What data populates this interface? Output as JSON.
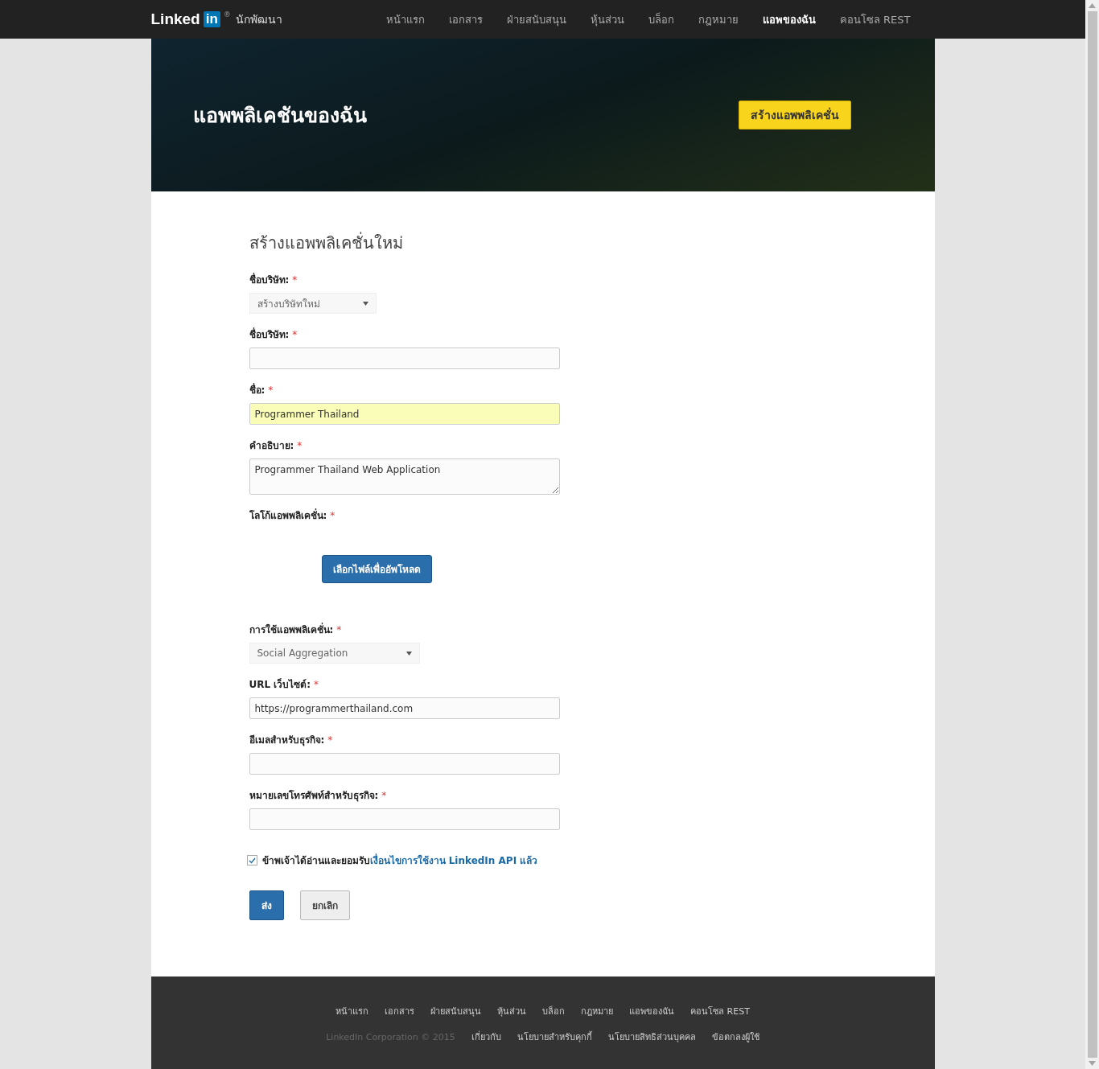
{
  "nav": {
    "logo_word": "Linked",
    "logo_badge": "in",
    "logo_mark": "®",
    "subtitle": "นักพัฒนา",
    "items": [
      {
        "label": "หน้าแรก",
        "selected": false
      },
      {
        "label": "เอกสาร",
        "selected": false
      },
      {
        "label": "ฝ่ายสนับสนุน",
        "selected": false
      },
      {
        "label": "หุ้นส่วน",
        "selected": false
      },
      {
        "label": "บล็อก",
        "selected": false
      },
      {
        "label": "กฎหมาย",
        "selected": false
      },
      {
        "label": "แอพของฉัน",
        "selected": true
      },
      {
        "label": "คอนโซล REST",
        "selected": false
      }
    ]
  },
  "hero": {
    "title": "แอพพลิเคชันของฉัน",
    "button": "สร้างแอพพลิเคชั่น"
  },
  "form": {
    "heading": "สร้างแอพพลิเคชั่นใหม่",
    "required_mark": "*",
    "fields": [
      {
        "kind": "select",
        "label": "ชื่อบริษัท:",
        "required": true,
        "value": "สร้างบริษัทใหม่"
      },
      {
        "kind": "input",
        "label": "ชื่อบริษัท:",
        "required": true,
        "autofilled": false
      },
      {
        "kind": "input",
        "label": "ชื่อ:",
        "required": true,
        "value": "Programmer Thailand",
        "autofilled": true
      },
      {
        "kind": "textarea",
        "label": "คำอธิบาย:",
        "required": true,
        "value": "Programmer Thailand Web Application"
      },
      {
        "kind": "file",
        "label": "โลโก้แอพพลิเคชั่น:",
        "required": true,
        "button": "เลือกไฟล์เพื่ออัพโหลด"
      },
      {
        "kind": "select",
        "label": "การใช้แอพพลิเคชั่น:",
        "required": true,
        "value": "Social Aggregation"
      },
      {
        "kind": "input",
        "label": "URL เว็บไซต์:",
        "required": true,
        "value": "https://programmerthailand.com",
        "autofilled": false
      },
      {
        "kind": "input",
        "label": "อีเมลสำหรับธุรกิจ:",
        "required": true,
        "autofilled": false
      },
      {
        "kind": "input",
        "label": "หมายเลขโทรศัพท์สำหรับธุรกิจ:",
        "required": true,
        "autofilled": false
      }
    ],
    "agreement": {
      "checked": true,
      "text": "ข้าพเจ้าได้อ่านและยอมรับ",
      "link": "เงื่อนไขการใช้งาน LinkedIn API แล้ว"
    },
    "buttons": [
      {
        "label": "ส่ง",
        "kind": "primary"
      },
      {
        "label": "ยกเลิก",
        "kind": "default"
      }
    ]
  },
  "footer": {
    "links": [
      "หน้าแรก",
      "เอกสาร",
      "ฝ่ายสนับสนุน",
      "หุ้นส่วน",
      "บล็อก",
      "กฎหมาย",
      "แอพของฉัน",
      "คอนโซล REST"
    ],
    "copyright": "LinkedIn Corporation © 2015",
    "legal": [
      "เกี่ยวกับ",
      "นโยบายสำหรับคุกกี้",
      "นโยบายสิทธิส่วนบุคคล",
      "ข้อตกลงผู้ใช้"
    ]
  }
}
